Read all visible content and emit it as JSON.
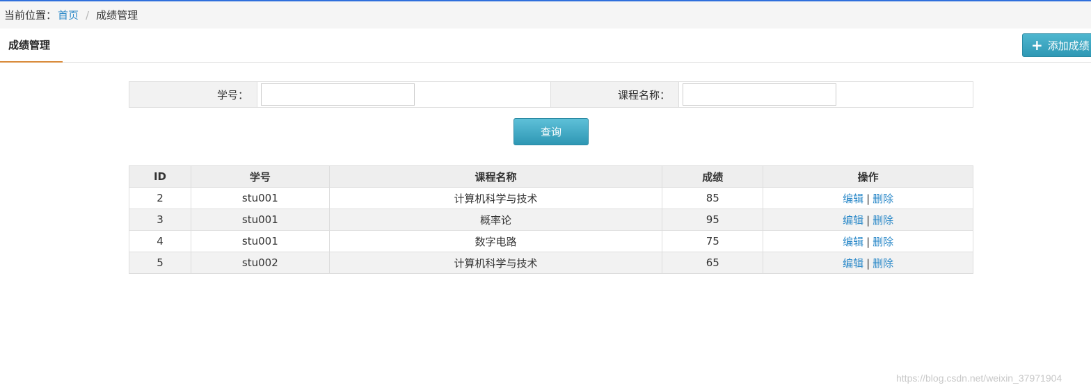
{
  "breadcrumb": {
    "prefix": "当前位置：",
    "home": "首页",
    "separator": "/",
    "current": "成绩管理"
  },
  "tabs": {
    "active_label": "成绩管理"
  },
  "toolbar": {
    "add_icon": "+",
    "add_label": "添加成绩"
  },
  "search": {
    "student_id_label": "学号：",
    "student_id_value": "",
    "course_name_label": "课程名称：",
    "course_name_value": "",
    "query_label": "查询"
  },
  "table": {
    "headers": [
      "ID",
      "学号",
      "课程名称",
      "成绩",
      "操作"
    ],
    "rows": [
      {
        "id": "2",
        "student_id": "stu001",
        "course": "计算机科学与技术",
        "score": "85"
      },
      {
        "id": "3",
        "student_id": "stu001",
        "course": "概率论",
        "score": "95"
      },
      {
        "id": "4",
        "student_id": "stu001",
        "course": "数字电路",
        "score": "75"
      },
      {
        "id": "5",
        "student_id": "stu002",
        "course": "计算机科学与技术",
        "score": "65"
      }
    ],
    "edit_label": "编辑",
    "action_separator": "|",
    "delete_label": "删除"
  },
  "watermark": "https://blog.csdn.net/weixin_37971904",
  "colors": {
    "accent_blue": "#2a88c8",
    "button_teal": "#2f98b4",
    "tab_underline": "#d88a3a",
    "top_line": "#2f6fdc"
  }
}
